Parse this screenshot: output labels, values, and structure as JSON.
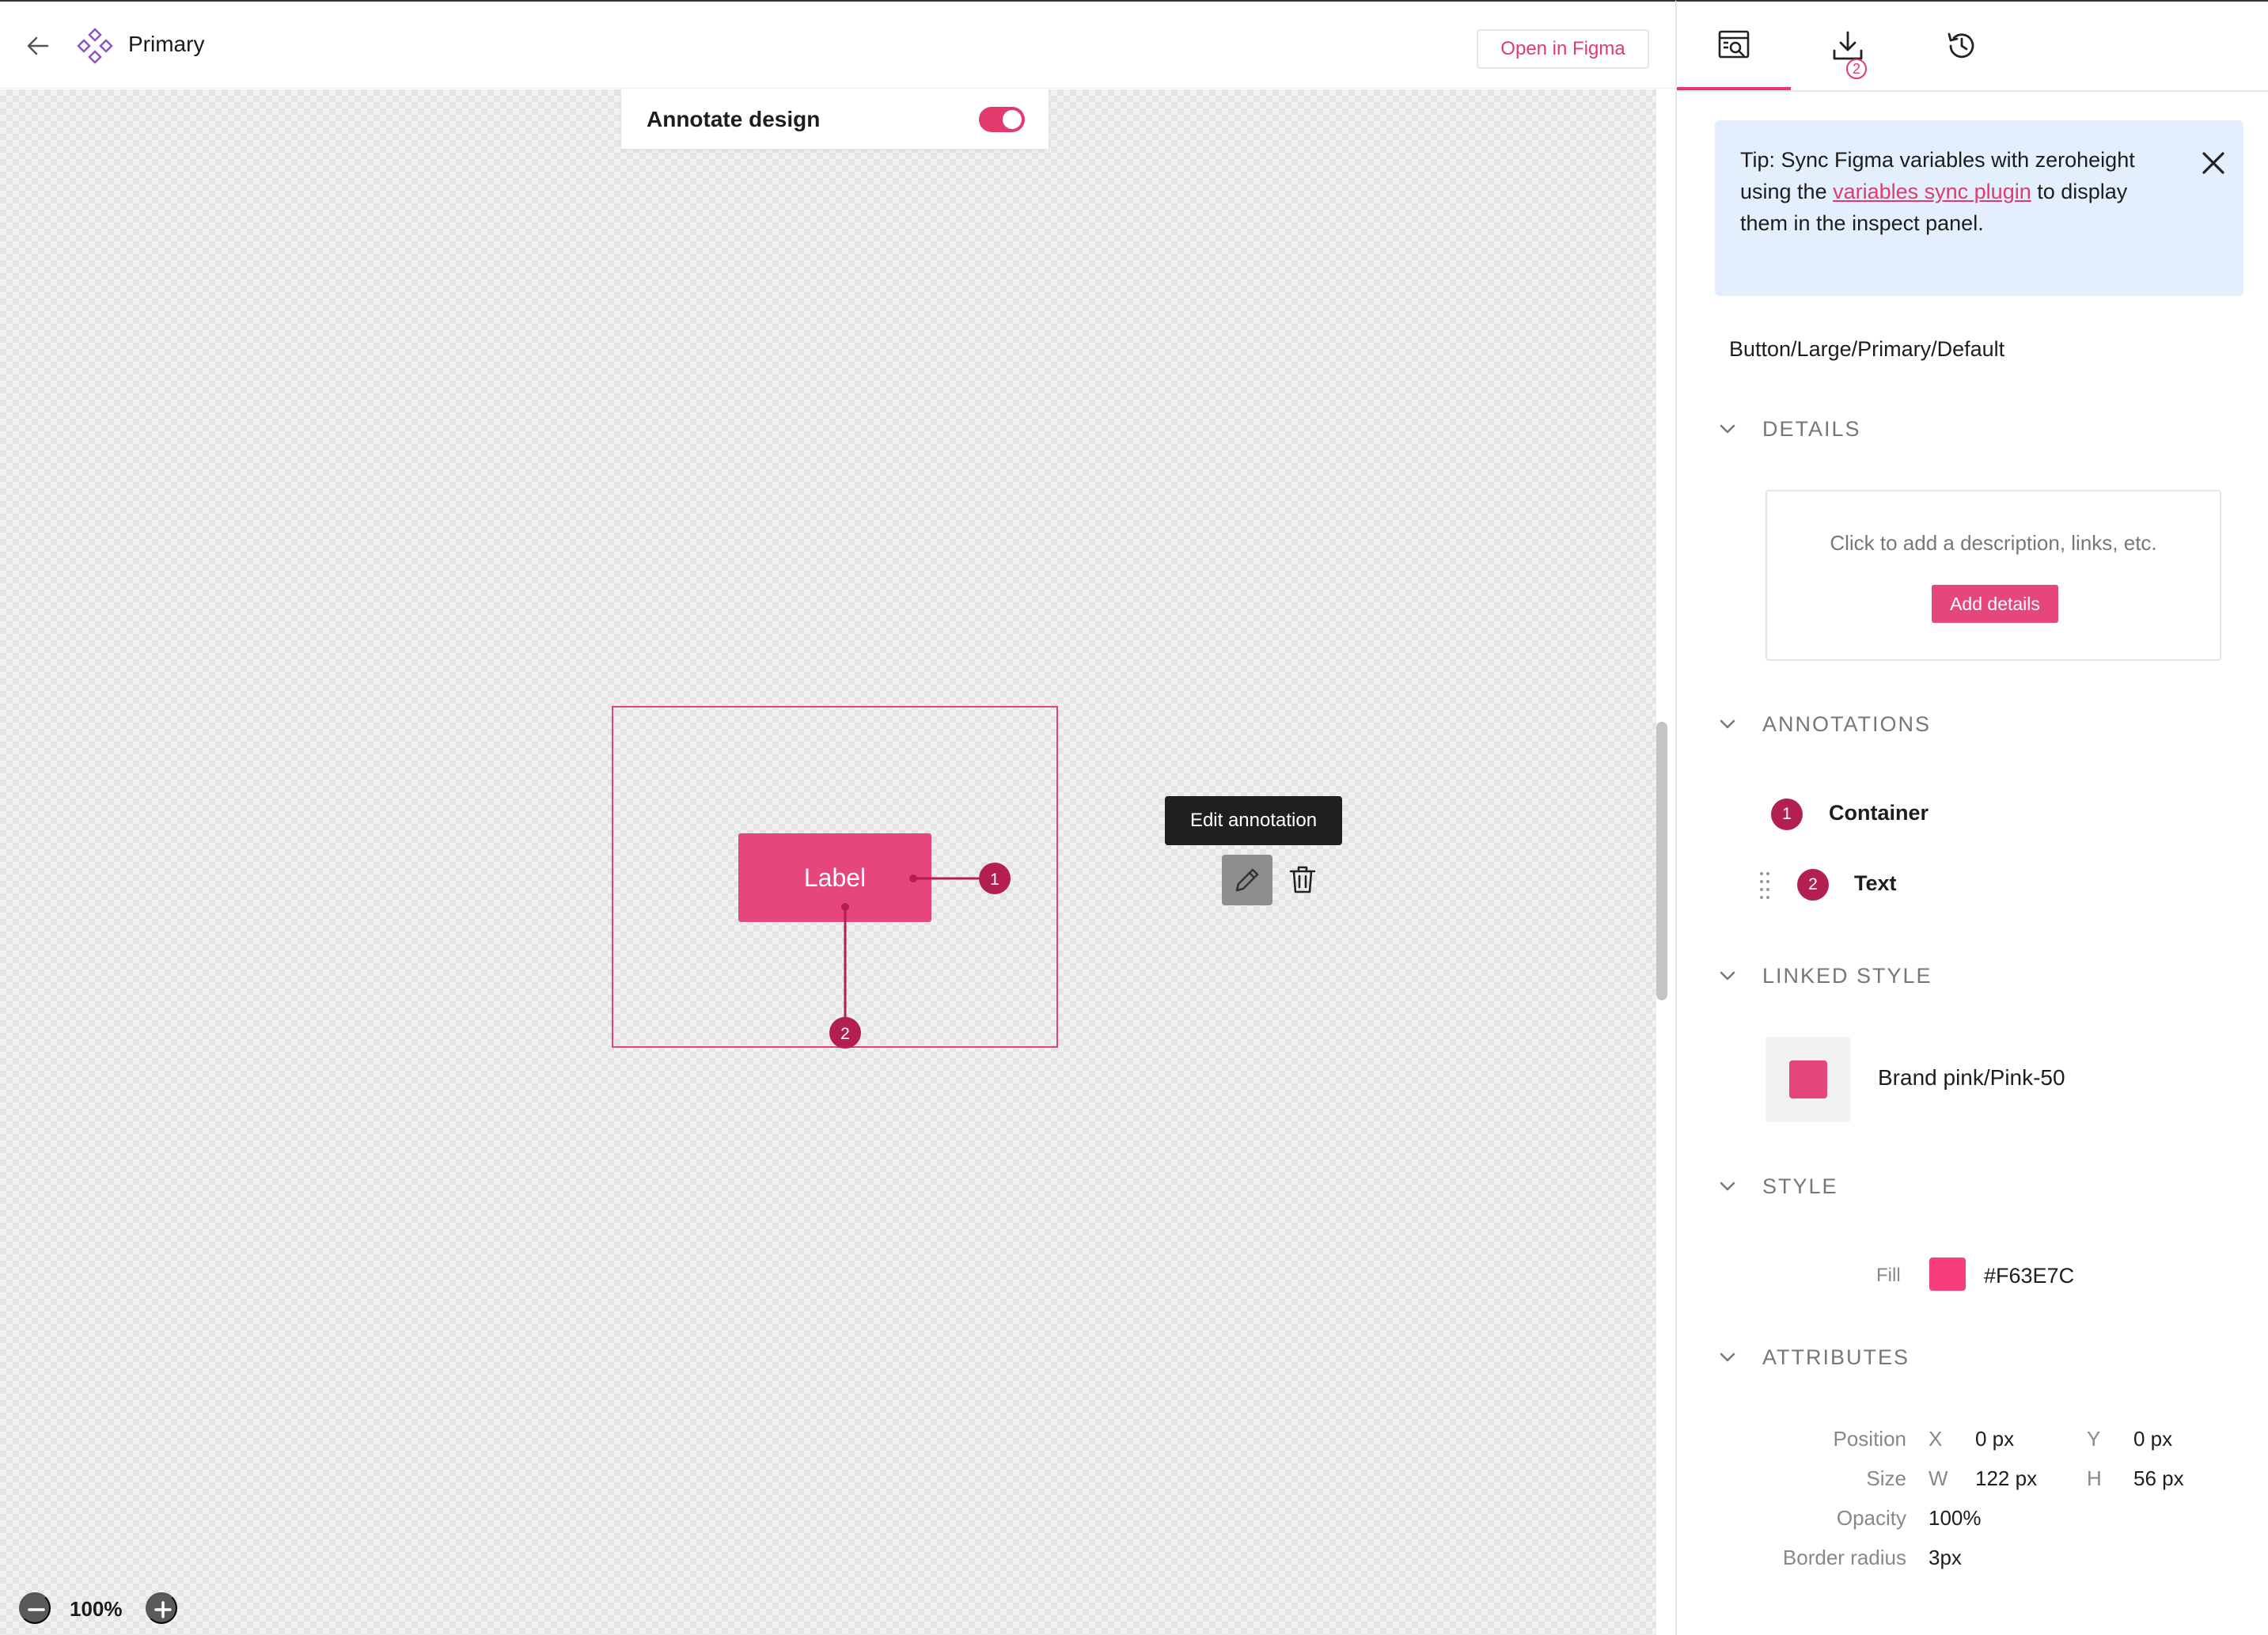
{
  "header": {
    "title": "Primary",
    "open_in_figma": "Open in Figma"
  },
  "canvas": {
    "annotate_label": "Annotate design",
    "annotate_enabled": true,
    "component_label": "Label",
    "markers": [
      "1",
      "2"
    ],
    "zoom_level": "100%"
  },
  "inspect": {
    "tabs": [
      "inspect-icon",
      "download-icon",
      "history-icon"
    ],
    "download_badge": "2",
    "tip": {
      "before": "Tip: Sync Figma variables with zeroheight using the ",
      "link": "variables sync plugin",
      "after": " to display them in the inspect panel."
    },
    "component_path": "Button/Large/Primary/Default",
    "details": {
      "title": "DETAILS",
      "hint": "Click to add a description, links, etc.",
      "button": "Add details"
    },
    "annotations": {
      "title": "ANNOTATIONS",
      "items": [
        {
          "number": "1",
          "name": "Container"
        },
        {
          "number": "2",
          "name": "Text"
        }
      ],
      "tooltip": "Edit annotation"
    },
    "linked_style": {
      "title": "LINKED STYLE",
      "name": "Brand pink/Pink-50",
      "color": "#E6467A"
    },
    "style": {
      "title": "STYLE",
      "fill_label": "Fill",
      "fill_value": "#F63E7C"
    },
    "attributes": {
      "title": "ATTRIBUTES",
      "position_label": "Position",
      "x_axis": "X",
      "x_value": "0 px",
      "y_axis": "Y",
      "y_value": "0 px",
      "size_label": "Size",
      "w_axis": "W",
      "w_value": "122 px",
      "h_axis": "H",
      "h_value": "56 px",
      "opacity_label": "Opacity",
      "opacity_value": "100%",
      "radius_label": "Border radius",
      "radius_value": "3px"
    }
  },
  "colors": {
    "accent": "#E23A6D",
    "marker": "#B3204F",
    "tip_bg": "#E3EFFD"
  }
}
